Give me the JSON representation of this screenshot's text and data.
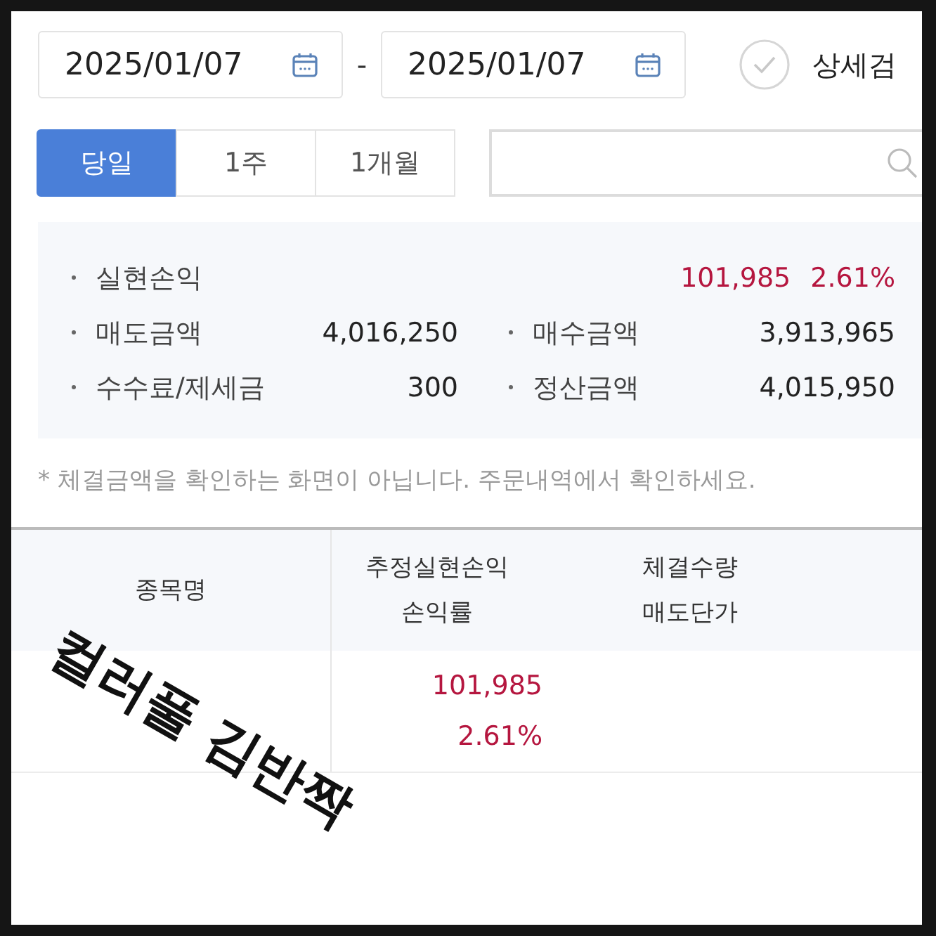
{
  "date_range": {
    "start": "2025/01/07",
    "separator": "-",
    "end": "2025/01/07"
  },
  "detail_search": {
    "label": "상세검",
    "checked": false
  },
  "period_tabs": [
    {
      "label": "당일",
      "selected": true
    },
    {
      "label": "1주",
      "selected": false
    },
    {
      "label": "1개월",
      "selected": false
    }
  ],
  "summary": {
    "realized": {
      "label": "실현손익",
      "value": "101,985",
      "rate": "2.61%"
    },
    "items": [
      {
        "label": "매도금액",
        "value": "4,016,250"
      },
      {
        "label": "매수금액",
        "value": "3,913,965"
      },
      {
        "label": "수수료/제세금",
        "value": "300"
      },
      {
        "label": "정산금액",
        "value": "4,015,950"
      }
    ]
  },
  "notice": "* 체결금액을 확인하는 화면이 아닙니다. 주문내역에서 확인하세요.",
  "table": {
    "columns": [
      [
        "종목명"
      ],
      [
        "추정실현손익",
        "손익률"
      ],
      [
        "체결수량",
        "매도단가"
      ]
    ],
    "rows": [
      {
        "profit": "101,985",
        "rate": "2.61%"
      }
    ]
  },
  "annotation": "컬러풀 김반짝"
}
